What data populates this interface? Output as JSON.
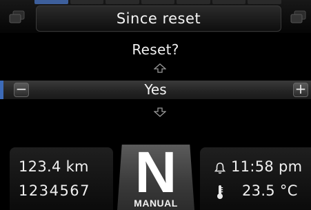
{
  "header": {
    "title": "Since reset",
    "left_icon": "window-stack-icon",
    "right_icon": "window-stack-icon"
  },
  "menu": {
    "prompt": "Reset?",
    "selected_value": "Yes",
    "decrement_label": "−",
    "increment_label": "+",
    "up_icon": "arrow-up-icon",
    "down_icon": "arrow-down-icon"
  },
  "status": {
    "trip_distance": "123.4 km",
    "odometer": "1234567",
    "gear": "N",
    "gear_mode": "MANUAL",
    "clock": "11:58 pm",
    "temperature": "23.5 °C"
  },
  "colors": {
    "background": "#000000",
    "accent": "#3d6bb8",
    "selection_bar": "#2a2a2a",
    "gear_box": "#4a4a4a"
  }
}
